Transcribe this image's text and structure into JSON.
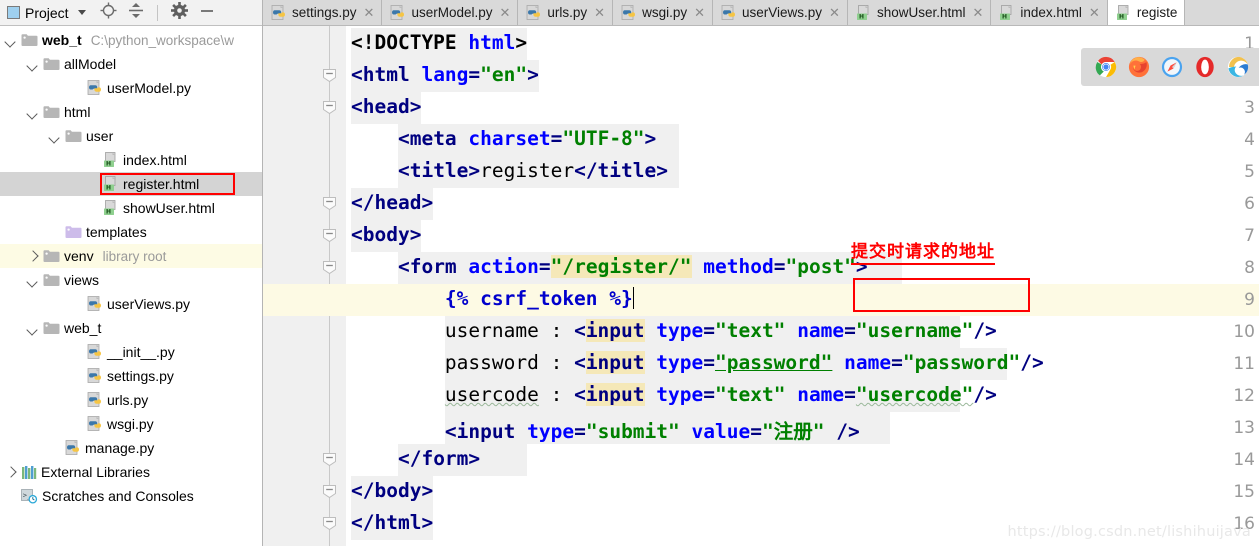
{
  "sidebar": {
    "panel_title": "Project",
    "toolbar_icons": [
      "locate-icon",
      "collapse-all-icon",
      "settings-gear-icon",
      "minimize-icon"
    ],
    "tree": [
      {
        "depth": 0,
        "arrow": "down",
        "icon": "folder-icon",
        "label": "web_t",
        "bold": true,
        "sub": "C:\\python_workspace\\w"
      },
      {
        "depth": 1,
        "arrow": "down",
        "icon": "folder-icon",
        "label": "allModel",
        "bold": false,
        "sub": ""
      },
      {
        "depth": 3,
        "arrow": "none",
        "icon": "python-file-icon",
        "label": "userModel.py",
        "bold": false,
        "sub": ""
      },
      {
        "depth": 1,
        "arrow": "down",
        "icon": "folder-icon",
        "label": "html",
        "bold": false,
        "sub": ""
      },
      {
        "depth": 2,
        "arrow": "down",
        "icon": "folder-icon",
        "label": "user",
        "bold": false,
        "sub": ""
      },
      {
        "depth": 4,
        "arrow": "none",
        "icon": "html-file-icon",
        "label": "index.html",
        "bold": false,
        "sub": ""
      },
      {
        "depth": 4,
        "arrow": "none",
        "icon": "html-file-icon",
        "label": "register.html",
        "bold": false,
        "sub": "",
        "selected": true,
        "highlighted": true
      },
      {
        "depth": 4,
        "arrow": "none",
        "icon": "html-file-icon",
        "label": "showUser.html",
        "bold": false,
        "sub": ""
      },
      {
        "depth": 2,
        "arrow": "none",
        "icon": "folder-purple-icon",
        "label": "templates",
        "bold": false,
        "sub": ""
      },
      {
        "depth": 1,
        "arrow": "right",
        "icon": "folder-icon",
        "label": "venv",
        "bold": false,
        "sub": "library root",
        "libroot": true
      },
      {
        "depth": 1,
        "arrow": "down",
        "icon": "folder-icon",
        "label": "views",
        "bold": false,
        "sub": ""
      },
      {
        "depth": 3,
        "arrow": "none",
        "icon": "python-file-icon",
        "label": "userViews.py",
        "bold": false,
        "sub": ""
      },
      {
        "depth": 1,
        "arrow": "down",
        "icon": "folder-icon",
        "label": "web_t",
        "bold": false,
        "sub": ""
      },
      {
        "depth": 3,
        "arrow": "none",
        "icon": "python-file-icon",
        "label": "__init__.py",
        "bold": false,
        "sub": ""
      },
      {
        "depth": 3,
        "arrow": "none",
        "icon": "python-file-icon",
        "label": "settings.py",
        "bold": false,
        "sub": ""
      },
      {
        "depth": 3,
        "arrow": "none",
        "icon": "python-file-icon",
        "label": "urls.py",
        "bold": false,
        "sub": ""
      },
      {
        "depth": 3,
        "arrow": "none",
        "icon": "python-file-icon",
        "label": "wsgi.py",
        "bold": false,
        "sub": ""
      },
      {
        "depth": 2,
        "arrow": "none",
        "icon": "python-file-icon",
        "label": "manage.py",
        "bold": false,
        "sub": ""
      },
      {
        "depth": 0,
        "arrow": "right",
        "icon": "libraries-icon",
        "label": "External Libraries",
        "bold": false,
        "sub": ""
      },
      {
        "depth": 0,
        "arrow": "none",
        "icon": "scratches-icon",
        "label": "Scratches and Consoles",
        "bold": false,
        "sub": ""
      }
    ]
  },
  "tabs": [
    {
      "label": "settings.py",
      "icon": "python-file-icon",
      "active": false,
      "closable": true
    },
    {
      "label": "userModel.py",
      "icon": "python-file-icon",
      "active": false,
      "closable": true
    },
    {
      "label": "urls.py",
      "icon": "python-file-icon",
      "active": false,
      "closable": true
    },
    {
      "label": "wsgi.py",
      "icon": "python-file-icon",
      "active": false,
      "closable": true
    },
    {
      "label": "userViews.py",
      "icon": "python-file-icon",
      "active": false,
      "closable": true
    },
    {
      "label": "showUser.html",
      "icon": "html-file-icon",
      "active": false,
      "closable": true
    },
    {
      "label": "index.html",
      "icon": "html-file-icon",
      "active": false,
      "closable": true
    },
    {
      "label": "registe",
      "icon": "html-file-icon",
      "active": true,
      "closable": false
    }
  ],
  "editor": {
    "current_line": 9,
    "line_numbers": [
      1,
      2,
      3,
      4,
      5,
      6,
      7,
      8,
      9,
      10,
      11,
      12,
      13,
      14,
      15,
      16
    ],
    "lines": [
      {
        "n": 1,
        "text": "<!DOCTYPE html>"
      },
      {
        "n": 2,
        "text": "<html lang=\"en\">"
      },
      {
        "n": 3,
        "text": "<head>"
      },
      {
        "n": 4,
        "text": "    <meta charset=\"UTF-8\">"
      },
      {
        "n": 5,
        "text": "    <title>register</title>"
      },
      {
        "n": 6,
        "text": "</head>"
      },
      {
        "n": 7,
        "text": "<body>"
      },
      {
        "n": 8,
        "text": "    <form action=\"/register/\" method=\"post\">"
      },
      {
        "n": 9,
        "text": "        {% csrf_token %}"
      },
      {
        "n": 10,
        "text": "        username : <input type=\"text\" name=\"username\"/>"
      },
      {
        "n": 11,
        "text": "        password : <input type=\"password\" name=\"password\"/>"
      },
      {
        "n": 12,
        "text": "        usercode : <input type=\"text\" name=\"usercode\"/>"
      },
      {
        "n": 13,
        "text": "        <input type=\"submit\" value=\"注册\" />"
      },
      {
        "n": 14,
        "text": "    </form>"
      },
      {
        "n": 15,
        "text": "</body>"
      },
      {
        "n": 16,
        "text": "</html>"
      }
    ],
    "fold_marker_lines": [
      2,
      3,
      6,
      7,
      8,
      14,
      15,
      16
    ]
  },
  "annotation": {
    "text": "提交时请求的地址",
    "color": "#ff0000",
    "boxed_code": "\"/register/\""
  },
  "browsers": {
    "items": [
      "chrome-icon",
      "firefox-icon",
      "safari-icon",
      "opera-icon",
      "edge-icon"
    ]
  },
  "watermark": "https://blog.csdn.net/lishihuijava",
  "colors": {
    "tag": "#000080",
    "attribute": "#0000ff",
    "value": "#008000",
    "annotation": "#ff0000",
    "current_line": "#fdfae4",
    "selection": "#d4d4d4",
    "gutter": "#f0f0f0",
    "tabbar": "#d9d9d9"
  }
}
